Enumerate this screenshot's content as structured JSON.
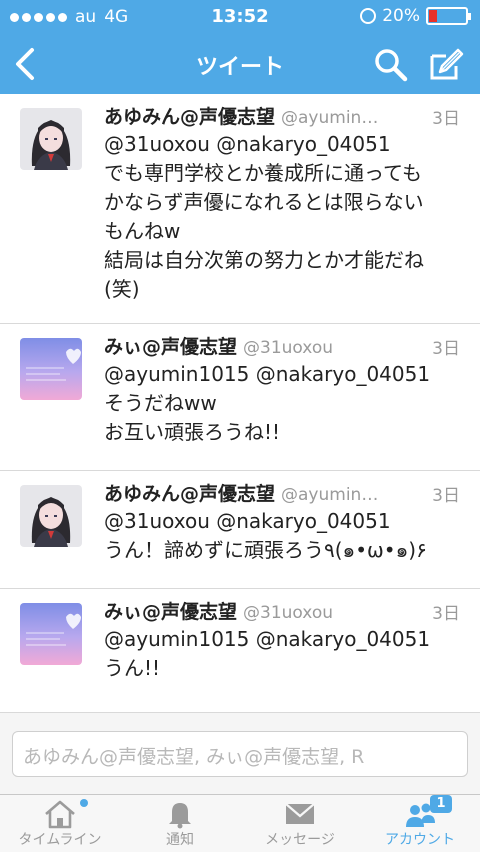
{
  "status_bar": {
    "carrier": "au",
    "network": "4G",
    "time": "13:52",
    "battery": "20%",
    "battery_level": 0.2,
    "colors": {
      "bar": "#4fa9e6",
      "battery_low": "#e8312a"
    }
  },
  "nav": {
    "title": "ツイート",
    "back_icon": "chevron-left-icon",
    "search_icon": "search-icon",
    "compose_icon": "compose-icon"
  },
  "tweets": [
    {
      "name": "あゆみん@声優志望",
      "handle": "@ayumin…",
      "time": "3日",
      "text": "@31uoxou @nakaryo_04051\nでも専門学校とか養成所に通っても\nかならず声優になれるとは限らない\nもんねw\n結局は自分次第の努力とか才能だね\n(笑)",
      "avatar": "anime-girl-avatar"
    },
    {
      "name": "みぃ@声優志望",
      "handle": "@31uoxou",
      "time": "3日",
      "text": "@ayumin1015 @nakaryo_04051\nそうだねww\nお互い頑張ろうね!!",
      "avatar": "pastel-sky-avatar"
    },
    {
      "name": "あゆみん@声優志望",
      "handle": "@ayumin…",
      "time": "3日",
      "text": "@31uoxou @nakaryo_04051\nうん！諦めずに頑張ろう٩(๑•ω•๑)۶",
      "avatar": "anime-girl-avatar"
    },
    {
      "name": "みぃ@声優志望",
      "handle": "@31uoxou",
      "time": "3日",
      "text": "@ayumin1015 @nakaryo_04051\nうん!!",
      "avatar": "pastel-sky-avatar"
    }
  ],
  "composer": {
    "placeholder": "あゆみん@声優志望, みぃ@声優志望, R"
  },
  "tabbar": {
    "tabs": [
      {
        "label": "タイムライン",
        "icon": "home-icon"
      },
      {
        "label": "通知",
        "icon": "bell-icon"
      },
      {
        "label": "メッセージ",
        "icon": "envelope-icon"
      },
      {
        "label": "アカウント",
        "icon": "people-icon",
        "badge": "1"
      }
    ],
    "active_index": 3,
    "accent": "#4fa9e6"
  }
}
